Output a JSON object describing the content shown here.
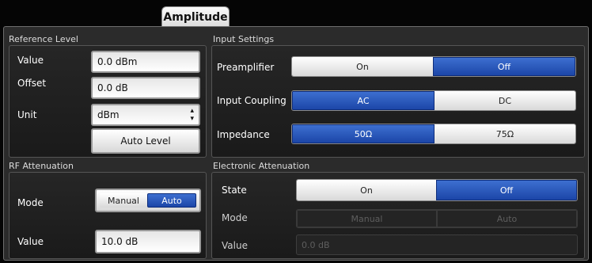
{
  "tab": {
    "label": "Amplitude"
  },
  "reference_level": {
    "title": "Reference Level",
    "value_label": "Value",
    "value": "0.0 dBm",
    "offset_label": "Offset",
    "offset": "0.0 dB",
    "unit_label": "Unit",
    "unit_selected": "dBm",
    "auto_level_label": "Auto Level"
  },
  "rf_attenuation": {
    "title": "RF Attenuation",
    "mode_label": "Mode",
    "mode_manual": "Manual",
    "mode_auto": "Auto",
    "mode_selected": "Auto",
    "value_label": "Value",
    "value": "10.0 dB"
  },
  "input_settings": {
    "title": "Input Settings",
    "preamplifier_label": "Preamplifier",
    "preamp_on": "On",
    "preamp_off": "Off",
    "preamp_selected": "Off",
    "coupling_label": "Input Coupling",
    "coupling_ac": "AC",
    "coupling_dc": "DC",
    "coupling_selected": "AC",
    "impedance_label": "Impedance",
    "impedance_50": "50Ω",
    "impedance_75": "75Ω",
    "impedance_selected": "50Ω"
  },
  "electronic_attenuation": {
    "title": "Electronic Attenuation",
    "state_label": "State",
    "state_on": "On",
    "state_off": "Off",
    "state_selected": "Off",
    "mode_label": "Mode",
    "mode_manual": "Manual",
    "mode_auto": "Auto",
    "value_label": "Value",
    "value": "0.0 dB"
  },
  "colors": {
    "accent_selected": "#2a58c0",
    "panel_bg": "#2b2b2b",
    "disabled_text": "#5e5e5e"
  }
}
